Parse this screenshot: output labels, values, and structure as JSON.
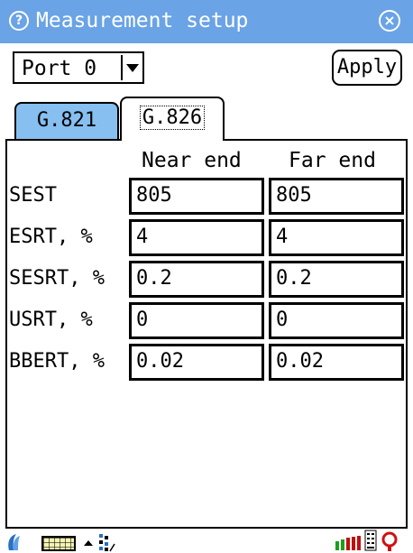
{
  "window": {
    "title": "Measurement setup",
    "help_glyph": "?",
    "close_glyph": "×",
    "accent_color": "#6aa3e6"
  },
  "toolbar": {
    "port_value": "Port 0",
    "apply_label": "Apply"
  },
  "tabs": [
    {
      "label": "G.821",
      "selected": false,
      "color": "#86bff0"
    },
    {
      "label": "G.826",
      "selected": true
    }
  ],
  "table": {
    "columns": [
      "Near end",
      "Far end"
    ],
    "rows": [
      {
        "label": "SEST",
        "near": "805",
        "far": "805"
      },
      {
        "label": "ESRT, %",
        "near": "4",
        "far": "4"
      },
      {
        "label": "SESRT, %",
        "near": "0.2",
        "far": "0.2"
      },
      {
        "label": "USRT, %",
        "near": "0",
        "far": "0"
      },
      {
        "label": "BBERT, %",
        "near": "0.02",
        "far": "0.02"
      }
    ]
  },
  "statusbar": {
    "icons": [
      "start-icon",
      "keyboard-icon",
      "up-arrow-icon",
      "network-icon",
      "battery-icon",
      "signal-icon",
      "record-icon"
    ]
  }
}
